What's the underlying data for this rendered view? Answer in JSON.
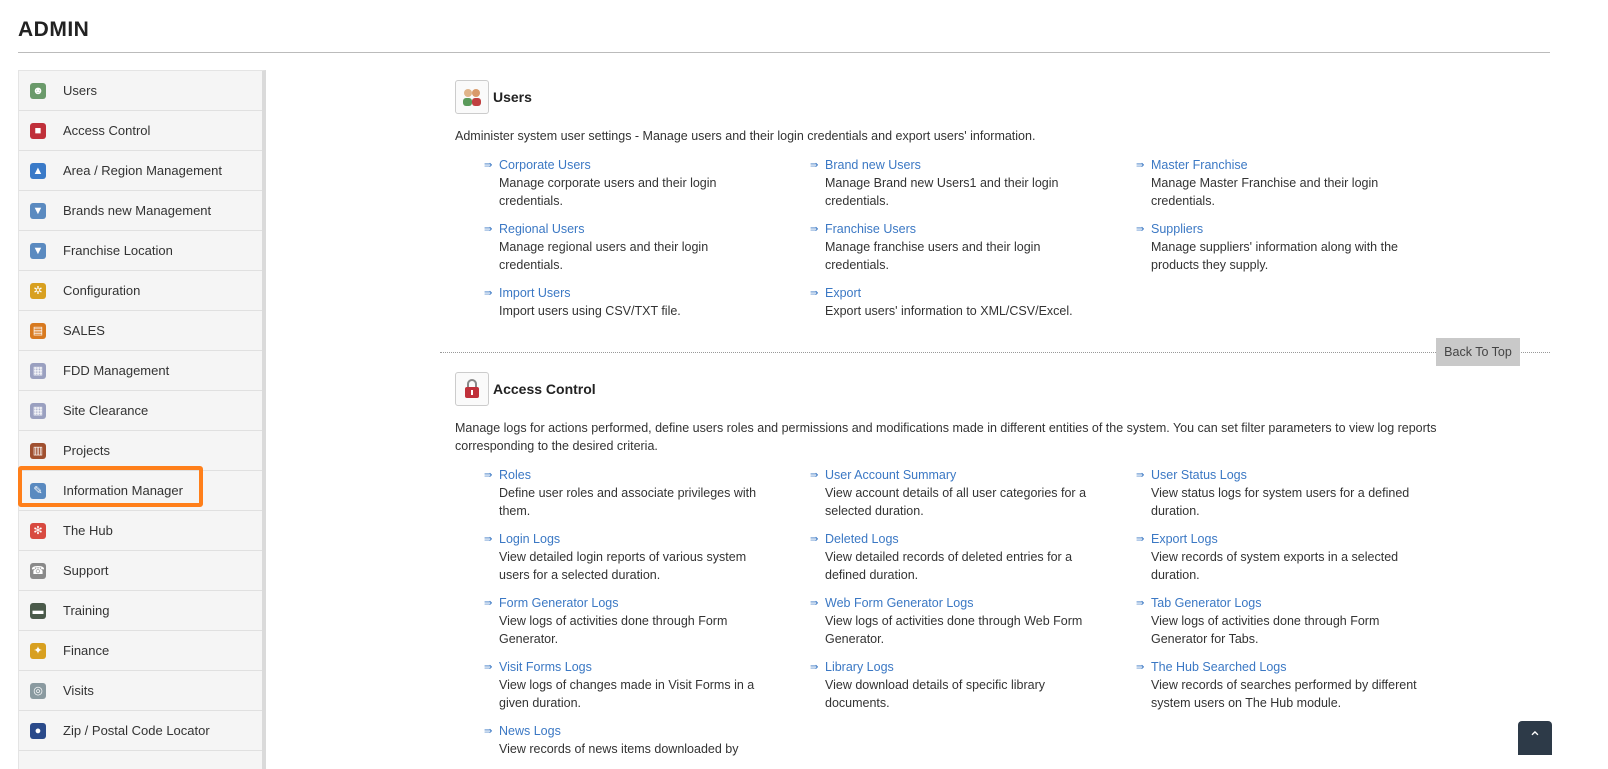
{
  "page": {
    "title": "ADMIN"
  },
  "sidebar": {
    "items": [
      {
        "label": "Users",
        "icon": "users-icon",
        "color": "#6a9a6a",
        "glyph": "☻"
      },
      {
        "label": "Access Control",
        "icon": "lock-icon",
        "color": "#c0303a",
        "glyph": "■"
      },
      {
        "label": "Area / Region Management",
        "icon": "map-icon",
        "color": "#3a7ac8",
        "glyph": "▲"
      },
      {
        "label": "Brands new Management",
        "icon": "brand-icon",
        "color": "#5a8ac0",
        "glyph": "▼"
      },
      {
        "label": "Franchise Location",
        "icon": "location-icon",
        "color": "#5a8ac0",
        "glyph": "▼"
      },
      {
        "label": "Configuration",
        "icon": "gears-icon",
        "color": "#d8a020",
        "glyph": "✲"
      },
      {
        "label": "SALES",
        "icon": "sales-icon",
        "color": "#d87a20",
        "glyph": "▤"
      },
      {
        "label": "FDD Management",
        "icon": "document-icon",
        "color": "#9aa0c0",
        "glyph": "▦"
      },
      {
        "label": "Site Clearance",
        "icon": "clearance-icon",
        "color": "#9aa0c0",
        "glyph": "▦"
      },
      {
        "label": "Projects",
        "icon": "projects-icon",
        "color": "#a05030",
        "glyph": "▥"
      },
      {
        "label": "Information Manager",
        "icon": "info-icon",
        "color": "#5a8ac0",
        "glyph": "✎"
      },
      {
        "label": "The Hub",
        "icon": "hub-icon",
        "color": "#d84a40",
        "glyph": "✻"
      },
      {
        "label": "Support",
        "icon": "support-icon",
        "color": "#8a8a8a",
        "glyph": "☎"
      },
      {
        "label": "Training",
        "icon": "training-icon",
        "color": "#4a5a4a",
        "glyph": "▬"
      },
      {
        "label": "Finance",
        "icon": "finance-icon",
        "color": "#d8a020",
        "glyph": "✦"
      },
      {
        "label": "Visits",
        "icon": "visits-icon",
        "color": "#8a9aa0",
        "glyph": "◎"
      },
      {
        "label": "Zip / Postal Code Locator",
        "icon": "globe-icon",
        "color": "#2a4a8a",
        "glyph": "●"
      }
    ]
  },
  "sections": {
    "users": {
      "title": "Users",
      "icon": "users-icon",
      "description": "Administer system user settings - Manage users and their login credentials and export users' information.",
      "links": [
        {
          "label": "Corporate Users",
          "desc": "Manage corporate users and their login credentials."
        },
        {
          "label": "Brand new Users",
          "desc": "Manage Brand new Users1 and their login credentials."
        },
        {
          "label": "Master Franchise",
          "desc": "Manage Master Franchise and their login credentials."
        },
        {
          "label": "Regional Users",
          "desc": "Manage regional users and their login credentials."
        },
        {
          "label": "Franchise Users",
          "desc": "Manage franchise users and their login credentials."
        },
        {
          "label": "Suppliers",
          "desc": "Manage suppliers' information along with the products they supply."
        },
        {
          "label": "Import Users",
          "desc": "Import users using CSV/TXT file."
        },
        {
          "label": "Export",
          "desc": "Export users' information to XML/CSV/Excel."
        }
      ]
    },
    "access": {
      "title": "Access Control",
      "icon": "lock-icon",
      "description": "Manage logs for actions performed, define users roles and permissions and modifications made in different entities of the system. You can set filter parameters to view log reports corresponding to the desired criteria.",
      "links": [
        {
          "label": "Roles",
          "desc": "Define user roles and associate privileges with them."
        },
        {
          "label": "User Account Summary",
          "desc": "View account details of all user categories for a selected duration."
        },
        {
          "label": "User Status Logs",
          "desc": "View status logs for system users for a defined duration."
        },
        {
          "label": "Login Logs",
          "desc": "View detailed login reports of various system users for a selected duration."
        },
        {
          "label": "Deleted Logs",
          "desc": "View detailed records of deleted entries for a defined duration."
        },
        {
          "label": "Export Logs",
          "desc": "View records of system exports in a selected duration."
        },
        {
          "label": "Form Generator Logs",
          "desc": "View logs of activities done through Form Generator."
        },
        {
          "label": "Web Form Generator Logs",
          "desc": "View logs of activities done through Web Form Generator."
        },
        {
          "label": "Tab Generator Logs",
          "desc": "View logs of activities done through Form Generator for Tabs."
        },
        {
          "label": "Visit Forms Logs",
          "desc": "View logs of changes made in Visit Forms in a given duration."
        },
        {
          "label": "Library Logs",
          "desc": "View download details of specific library documents."
        },
        {
          "label": "The Hub Searched Logs",
          "desc": "View records of searches performed by different system users on The Hub module."
        },
        {
          "label": "News Logs",
          "desc": "View records of news items downloaded by"
        }
      ]
    }
  },
  "back_to_top": "Back To Top",
  "highlight": {
    "item": "Information Manager",
    "color": "#ff7f1a"
  }
}
